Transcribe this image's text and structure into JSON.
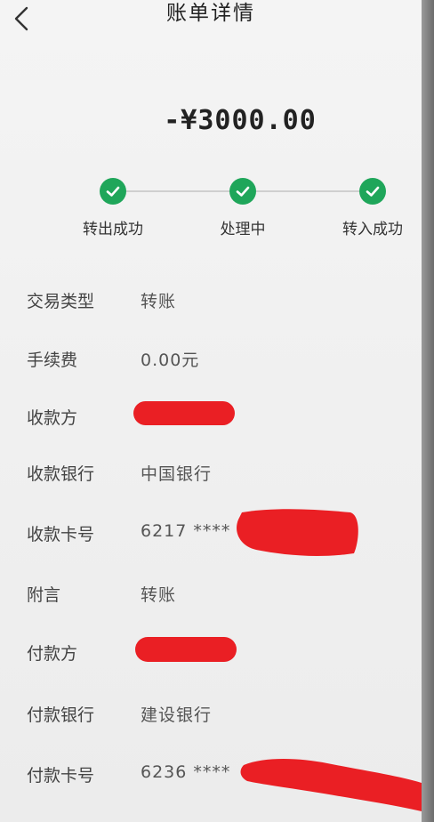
{
  "header": {
    "title": "账单详情",
    "back_icon": "chevron-left-icon"
  },
  "amount": "-¥3000.00",
  "progress": {
    "status_color": "#1fa65a",
    "steps": [
      {
        "label": "转出成功",
        "done": true
      },
      {
        "label": "处理中",
        "done": true
      },
      {
        "label": "转入成功",
        "done": true
      }
    ]
  },
  "details": {
    "transaction_type": {
      "label": "交易类型",
      "value": "转账"
    },
    "fee": {
      "label": "手续费",
      "value": "0.00元"
    },
    "payee": {
      "label": "收款方",
      "value": ""
    },
    "payee_bank": {
      "label": "收款银行",
      "value": "中国银行"
    },
    "payee_card": {
      "label": "收款卡号",
      "value": "6217 ****"
    },
    "note": {
      "label": "附言",
      "value": "转账"
    },
    "payer": {
      "label": "付款方",
      "value": ""
    },
    "payer_bank": {
      "label": "付款银行",
      "value": "建设银行"
    },
    "payer_card": {
      "label": "付款卡号",
      "value": "6236 ****"
    }
  },
  "redaction_color": "#ea1f24"
}
